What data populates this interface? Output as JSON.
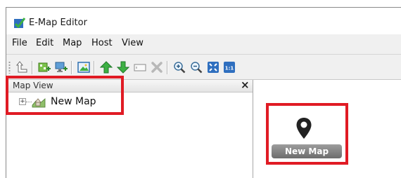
{
  "window": {
    "title": "E-Map Editor"
  },
  "menu": {
    "items": [
      "File",
      "Edit",
      "Map",
      "Host",
      "View"
    ]
  },
  "toolbar": {
    "buttons": [
      "upload-icon",
      "add-map-icon",
      "add-host-icon",
      "image-icon",
      "move-up-icon",
      "move-down-icon",
      "rename-icon",
      "delete-icon",
      "zoom-in-icon",
      "zoom-out-icon",
      "fit-to-window-icon",
      "actual-size-icon"
    ],
    "actual_size_label": "1:1"
  },
  "panel": {
    "title": "Map View",
    "close_glyph": "×"
  },
  "tree": {
    "expander": "+",
    "item_label": "New Map"
  },
  "map": {
    "marker_label": "New Map"
  },
  "colors": {
    "highlight": "#e01b24",
    "accent_green": "#3cb043",
    "pin": "#222222"
  }
}
